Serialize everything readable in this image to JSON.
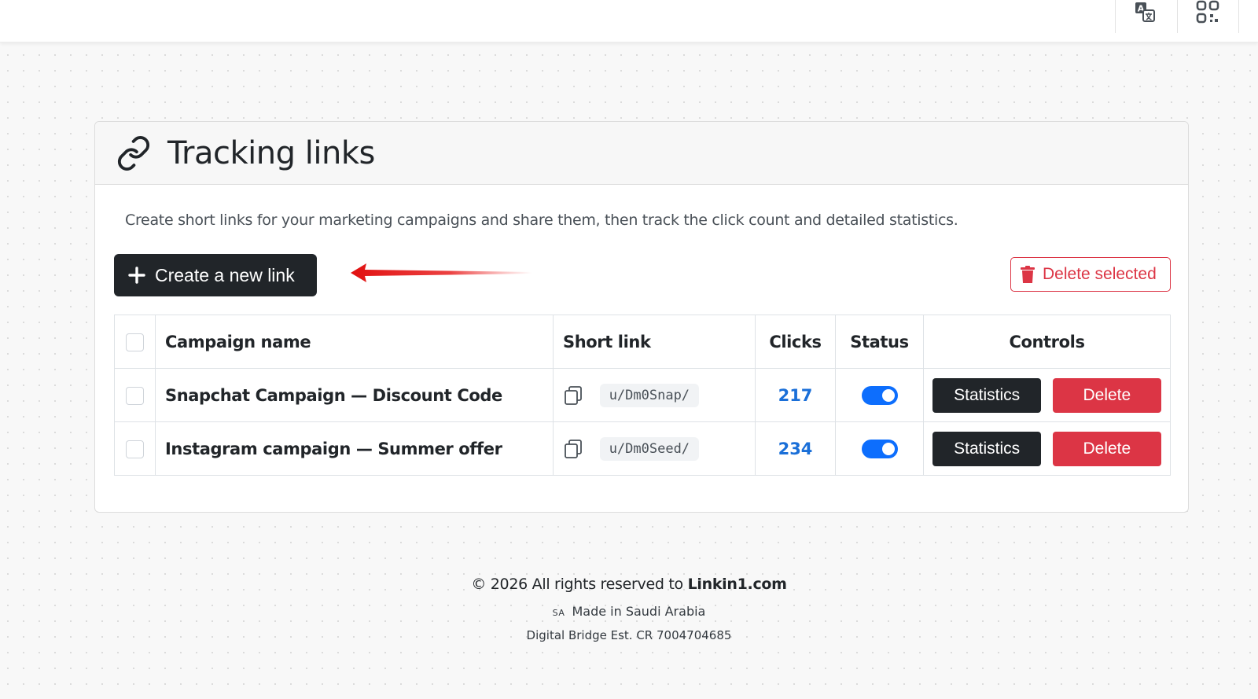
{
  "topbar": {
    "icons": [
      "translate-icon",
      "qr-code-icon"
    ]
  },
  "card": {
    "title": "Tracking links",
    "description": "Create short links for your marketing campaigns and share them, then track the click count and detailed statistics.",
    "create_button_label": "Create a new link",
    "delete_selected_label": "Delete selected"
  },
  "table": {
    "headers": {
      "campaign_name": "Campaign name",
      "short_link": "Short link",
      "clicks": "Clicks",
      "status": "Status",
      "controls": "Controls"
    },
    "rows": [
      {
        "name": "Snapchat Campaign — Discount Code",
        "short_link": "u/Dm0Snap/",
        "clicks": "217",
        "status_enabled": true,
        "statistics_label": "Statistics",
        "delete_label": "Delete"
      },
      {
        "name": "Instagram campaign — Summer offer",
        "short_link": "u/Dm0Seed/",
        "clicks": "234",
        "status_enabled": true,
        "statistics_label": "Statistics",
        "delete_label": "Delete"
      }
    ]
  },
  "footer": {
    "copyright_prefix": "© 2026 All rights reserved to",
    "site": "Linkin1.com",
    "flag": "SA",
    "made_in": "Made in Saudi Arabia",
    "company": "Digital Bridge Est. CR 7004704685"
  },
  "colors": {
    "primary_dark": "#212529",
    "danger": "#dc3545",
    "toggle_on": "#0d6efd",
    "clicks": "#1a6fd8"
  }
}
